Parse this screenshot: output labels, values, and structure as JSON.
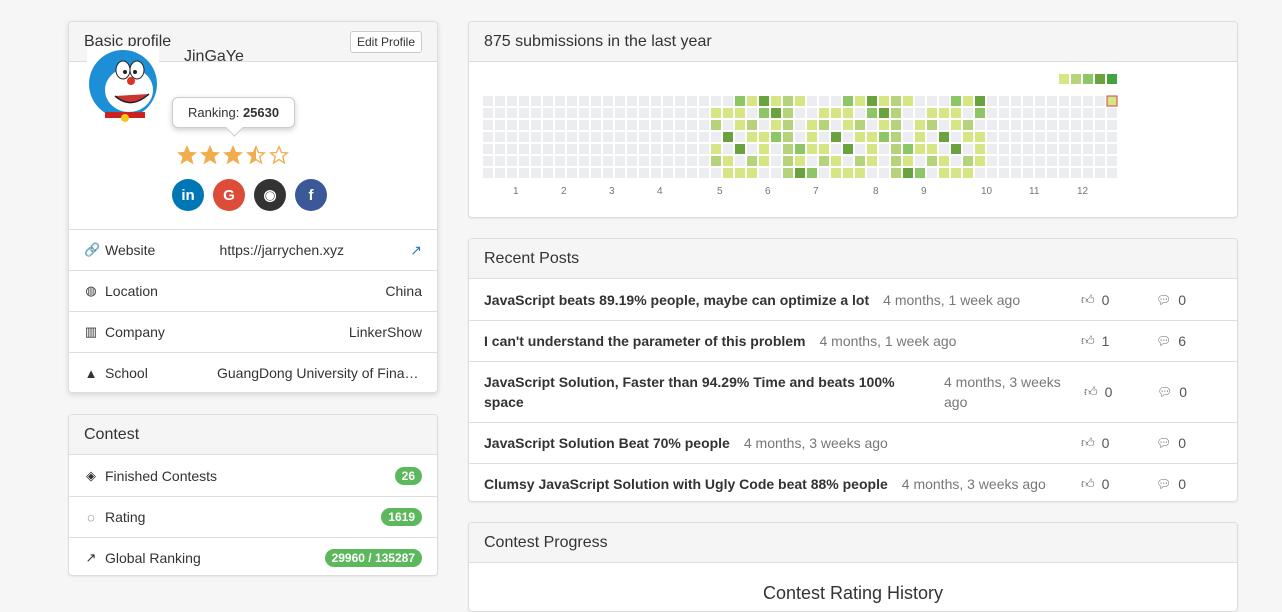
{
  "profile": {
    "title": "Basic profile",
    "edit_label": "Edit Profile",
    "username": "JinGaYe",
    "ranking_label": "Ranking:",
    "ranking_value": "25630",
    "rating_stars": 3.5,
    "rows": [
      {
        "icon": "link-icon",
        "label": "Website",
        "value": "https://jarrychen.xyz"
      },
      {
        "icon": "globe-icon",
        "label": "Location",
        "value": "China"
      },
      {
        "icon": "building-icon",
        "label": "Company",
        "value": "LinkerShow"
      },
      {
        "icon": "graduation-cap-icon",
        "label": "School",
        "value": "GuangDong University of Finance"
      }
    ],
    "socials": [
      {
        "name": "linkedin-icon",
        "glyph": "in",
        "color": "#0077b5"
      },
      {
        "name": "google-icon",
        "glyph": "G",
        "color": "#dd4b39"
      },
      {
        "name": "github-icon",
        "glyph": "◉",
        "color": "#333333"
      },
      {
        "name": "facebook-icon",
        "glyph": "f",
        "color": "#3b5998"
      }
    ]
  },
  "contest": {
    "title": "Contest",
    "rows": [
      {
        "icon": "cubes-icon",
        "label": "Finished Contests",
        "value": "26"
      },
      {
        "icon": "lightbulb-icon",
        "label": "Rating",
        "value": "1619"
      },
      {
        "icon": "line-chart-icon",
        "label": "Global Ranking",
        "value": "29960 / 135287"
      }
    ]
  },
  "submissions": {
    "title": "875 submissions in the last year",
    "months": [
      "1",
      "2",
      "3",
      "4",
      "5",
      "6",
      "7",
      "8",
      "9",
      "10",
      "11",
      "12"
    ],
    "legend_colors": [
      "#d6e685",
      "#b5d37a",
      "#8cc665",
      "#6aa33e",
      "#44a340"
    ]
  },
  "posts": {
    "title": "Recent Posts",
    "items": [
      {
        "title": "JavaScript beats 89.19% people, maybe can optimize a lot",
        "time": "4 months, 1 week ago",
        "likes": "0",
        "comments": "0"
      },
      {
        "title": "I can't understand the parameter of this problem",
        "time": "4 months, 1 week ago",
        "likes": "1",
        "comments": "6"
      },
      {
        "title": "JavaScript Solution, Faster than 94.29% Time and beats 100% space",
        "time": "4 months, 3 weeks ago",
        "likes": "0",
        "comments": "0"
      },
      {
        "title": "JavaScript Solution Beat 70% people",
        "time": "4 months, 3 weeks ago",
        "likes": "0",
        "comments": "0"
      },
      {
        "title": "Clumsy JavaScript Solution with Ugly Code beat 88% people",
        "time": "4 months, 3 weeks ago",
        "likes": "0",
        "comments": "0"
      }
    ]
  },
  "progress": {
    "title": "Contest Progress",
    "chart_title": "Contest Rating History"
  }
}
